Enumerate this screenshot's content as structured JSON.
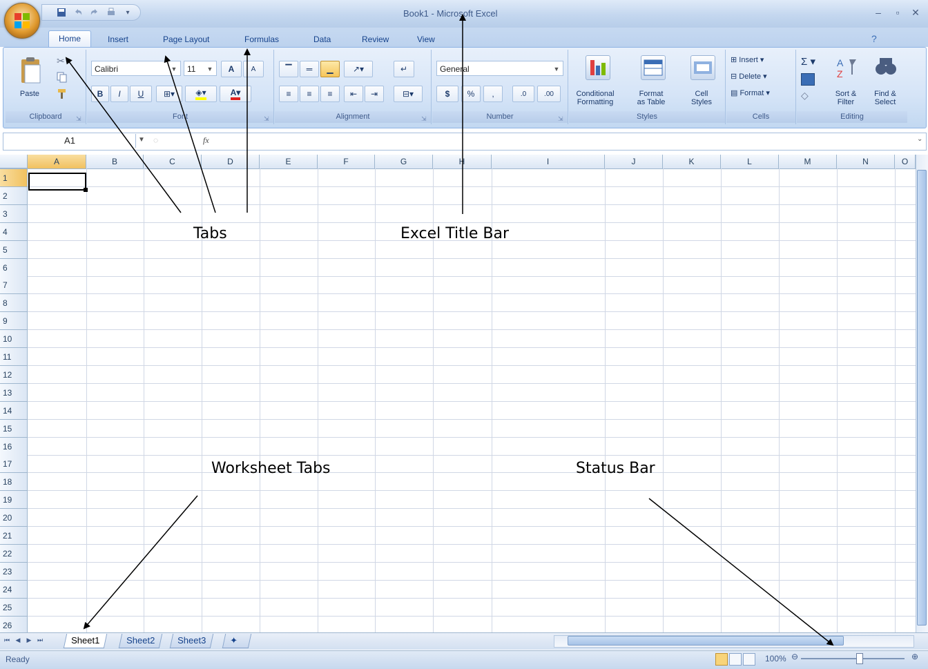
{
  "title_bar": {
    "title": "Book1 - Microsoft Excel"
  },
  "ribbon_tabs": [
    "Home",
    "Insert",
    "Page Layout",
    "Formulas",
    "Data",
    "Review",
    "View"
  ],
  "clipboard": {
    "paste_label": "Paste",
    "group_label": "Clipboard"
  },
  "font": {
    "font_name": "Calibri",
    "font_size": "11",
    "bold": "B",
    "italic": "I",
    "underline": "U",
    "grow": "A",
    "shrink": "A",
    "group_label": "Font"
  },
  "alignment": {
    "group_label": "Alignment"
  },
  "number": {
    "format": "General",
    "currency": "$",
    "percent": "%",
    "comma": ",",
    "inc_decimal": ".0",
    "dec_decimal": ".00",
    "group_label": "Number"
  },
  "styles": {
    "conditional": [
      "Conditional",
      "Formatting"
    ],
    "format_table": [
      "Format",
      "as Table"
    ],
    "cell_styles": [
      "Cell",
      "Styles"
    ],
    "group_label": "Styles"
  },
  "cells": {
    "insert": "Insert",
    "delete": "Delete",
    "format": "Format",
    "group_label": "Cells"
  },
  "editing": {
    "sum": "Σ",
    "sort_filter": [
      "Sort &",
      "Filter"
    ],
    "find_select": [
      "Find &",
      "Select"
    ],
    "group_label": "Editing"
  },
  "formula_bar": {
    "name_box": "A1",
    "fx": "fx",
    "formula": ""
  },
  "columns": [
    "A",
    "B",
    "C",
    "D",
    "E",
    "F",
    "G",
    "H",
    "I",
    "J",
    "K",
    "L",
    "M",
    "N",
    "O"
  ],
  "rows": [
    "1",
    "2",
    "3",
    "4",
    "5",
    "6",
    "7",
    "8",
    "9",
    "10",
    "11",
    "12",
    "13",
    "14",
    "15",
    "16",
    "17",
    "18",
    "19",
    "20",
    "21",
    "22",
    "23",
    "24",
    "25",
    "26"
  ],
  "sheet_tabs": [
    "Sheet1",
    "Sheet2",
    "Sheet3"
  ],
  "status": {
    "text": "Ready",
    "zoom": "100%"
  },
  "annotations": {
    "tabs": "Tabs",
    "title_bar": "Excel Title Bar",
    "worksheet_tabs": "Worksheet Tabs",
    "status_bar": "Status Bar"
  },
  "colors": {
    "ribbon": "#d5e4f7",
    "accent": "#15428b",
    "grid": "#d0d7e5"
  }
}
